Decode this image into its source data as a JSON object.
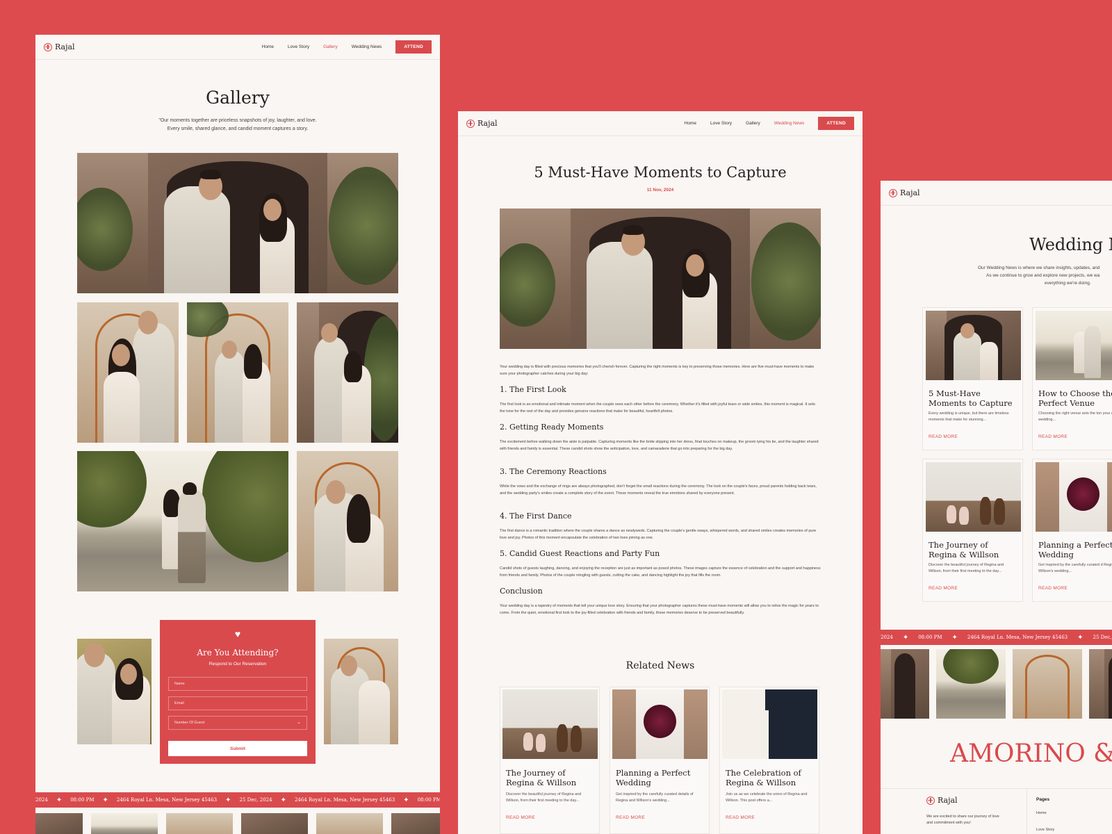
{
  "brand": {
    "name": "Rajal",
    "accent": "#d94a4d",
    "background": "#dd4b4e"
  },
  "nav": {
    "home": "Home",
    "love_story": "Love Story",
    "gallery": "Gallery",
    "wedding_news": "Wedding News",
    "attend": "ATTEND"
  },
  "gallery_page": {
    "title": "Gallery",
    "subtitle_line1": "\"Our moments together are priceless snapshots of joy, laughter, and love.",
    "subtitle_line2": "Every smile, shared glance, and candid moment captures a story.",
    "rsvp": {
      "heading": "Are You Attending?",
      "subheading": "Respond to Our Reservation",
      "name_placeholder": "Name",
      "email_placeholder": "Email",
      "guest_placeholder": "Number Of Guest",
      "submit": "Submit"
    },
    "ticker": [
      "2024",
      "08:00 PM",
      "2464 Royal Ln. Mesa, New Jersey 45463",
      "25 Dec, 2024",
      "2464 Royal Ln. Mesa, New Jersey 45463",
      "08:00 PM"
    ]
  },
  "article_page": {
    "title": "5 Must-Have Moments to Capture",
    "date": "11 Nov, 2024",
    "intro": "Your wedding day is filled with precious memories that you'll cherish forever. Capturing the right moments is key to preserving those memories. Here are five must-have moments to make sure your photographer catches during your big day:",
    "sections": [
      {
        "heading": "1. The First Look",
        "body": "The first look is an emotional and intimate moment when the couple sees each other before the ceremony. Whether it's filled with joyful tears or wide smiles, this moment is magical. It sets the tone for the rest of the day and provides genuine reactions that make for beautiful, heartfelt photos."
      },
      {
        "heading": "2. Getting Ready Moments",
        "body": "The excitement before walking down the aisle is palpable. Capturing moments like the bride slipping into her dress, final touches on makeup, the groom tying his tie, and the laughter shared with friends and family is essential. These candid shots show the anticipation, love, and camaraderie that go into preparing for the big day."
      },
      {
        "heading": "3. The Ceremony Reactions",
        "body": "While the vows and the exchange of rings are always photographed, don't forget the small reactions during the ceremony. The look on the couple's faces, proud parents holding back tears, and the wedding party's smiles create a complete story of the event. These moments reveal the true emotions shared by everyone present."
      },
      {
        "heading": "4. The First Dance",
        "body": "The first dance is a romantic tradition where the couple shares a dance as newlyweds. Capturing the couple's gentle sways, whispered words, and shared smiles creates memories of pure love and joy. Photos of this moment encapsulate the celebration of two lives joining as one."
      },
      {
        "heading": "5. Candid Guest Reactions and Party Fun",
        "body": "Candid shots of guests laughing, dancing, and enjoying the reception are just as important as posed photos. These images capture the essence of celebration and the support and happiness from friends and family. Photos of the couple mingling with guests, cutting the cake, and dancing highlight the joy that fills the room."
      },
      {
        "heading": "Conclusion",
        "body": "Your wedding day is a tapestry of moments that tell your unique love story. Ensuring that your photographer captures these must-have moments will allow you to relive the magic for years to come. From the quiet, emotional first look to the joy-filled celebration with friends and family, these memories deserve to be preserved beautifully."
      }
    ],
    "related_title": "Related News",
    "related": [
      {
        "title": "The Journey of Regina & Willson",
        "excerpt": "Discover the beautiful journey of Regina and Willson, from their first meeting to the day...",
        "more": "READ MORE"
      },
      {
        "title": "Planning a Perfect Wedding",
        "excerpt": "Get inspired by the carefully curated details of Regina and Willson's wedding...",
        "more": "READ MORE"
      },
      {
        "title": "The Celebration of Regina & Willson",
        "excerpt": "Join us as we celebrate the union of Regina and Willson. This post offers a...",
        "more": "READ MORE"
      }
    ]
  },
  "news_page": {
    "title": "Wedding Ne",
    "desc_line1": "Our Wedding News is where we share insights, updates, and",
    "desc_line2": "As we continue to grow and explore new projects, we wa",
    "desc_line3": "everything we're doing.",
    "cards": [
      {
        "title": "5 Must-Have Moments to Capture",
        "excerpt": "Every wedding is unique, but there are timeless moments that make for stunning...",
        "more": "READ MORE"
      },
      {
        "title": "How to Choose the Perfect Venue",
        "excerpt": "Choosing the right venue sets the ton your entire wedding...",
        "more": "READ MORE"
      },
      {
        "title": "The Journey of Regina & Willson",
        "excerpt": "Discover the beautiful journey of Regina and Willson, from their first meeting to the day...",
        "more": "READ MORE"
      },
      {
        "title": "Planning a Perfect Wedding",
        "excerpt": "Get inspired by the carefully curated d Regina and Willson's wedding...",
        "more": "READ MORE"
      }
    ],
    "ticker": [
      "2024",
      "08:00 PM",
      "2464 Royal Ln. Mesa, New Jersey 45463",
      "25 Dec, 2024"
    ],
    "big_text": "AMORINO &",
    "footer_desc_line1": "We are excited to share our journey of love",
    "footer_desc_line2": "and commitment with you!",
    "footer_pages_title": "Pages",
    "footer_home": "Home",
    "footer_love_story": "Love Story"
  }
}
